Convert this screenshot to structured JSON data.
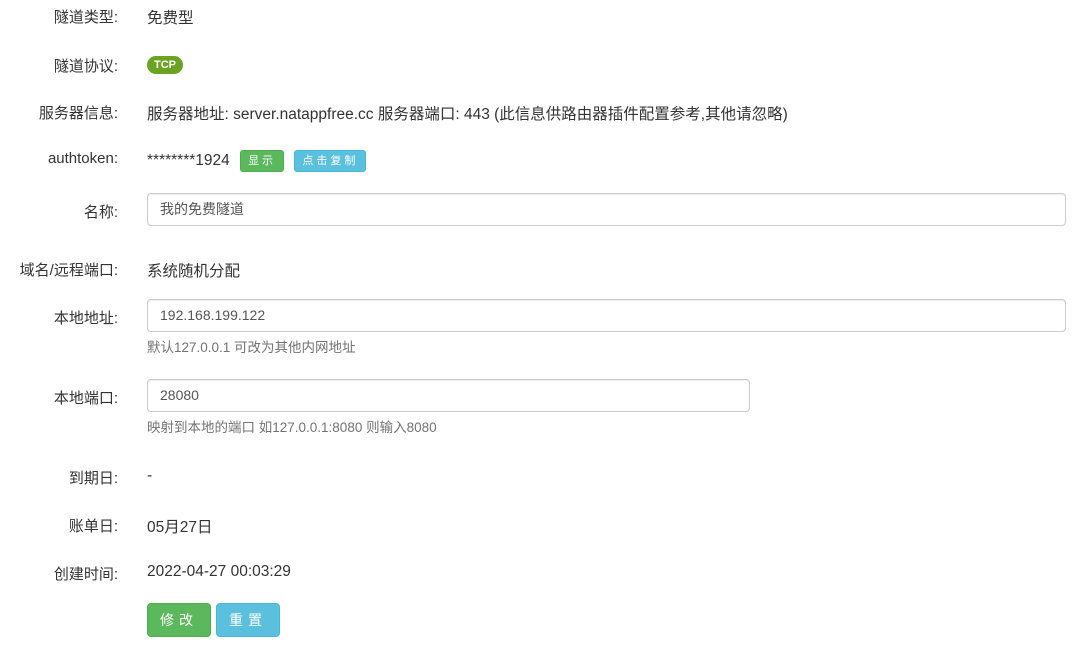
{
  "tunnel_type": {
    "label": "隧道类型:",
    "value": "免费型"
  },
  "tunnel_protocol": {
    "label": "隧道协议:",
    "badge": "TCP"
  },
  "server_info": {
    "label": "服务器信息:",
    "value": "服务器地址: server.natappfree.cc 服务器端口: 443 (此信息供路由器插件配置参考,其他请忽略)"
  },
  "authtoken": {
    "label": "authtoken:",
    "value": "********1924",
    "show_button": "显示",
    "copy_button": "点击复制"
  },
  "name": {
    "label": "名称:",
    "value": "我的免费隧道"
  },
  "domain_port": {
    "label": "域名/远程端口:",
    "value": "系统随机分配"
  },
  "local_address": {
    "label": "本地地址:",
    "value": "192.168.199.122",
    "help": "默认127.0.0.1 可改为其他内网地址"
  },
  "local_port": {
    "label": "本地端口:",
    "value": "28080",
    "help": "映射到本地的端口 如127.0.0.1:8080 则输入8080"
  },
  "expiry_date": {
    "label": "到期日:",
    "value": "-"
  },
  "billing_date": {
    "label": "账单日:",
    "value": "05月27日"
  },
  "created_time": {
    "label": "创建时间:",
    "value": "2022-04-27 00:03:29"
  },
  "actions": {
    "modify_button": "修改",
    "reset_button": "重置"
  },
  "colors": {
    "green": "#5cb85c",
    "cyan": "#5bc0de",
    "badge_green": "#6aa321"
  }
}
